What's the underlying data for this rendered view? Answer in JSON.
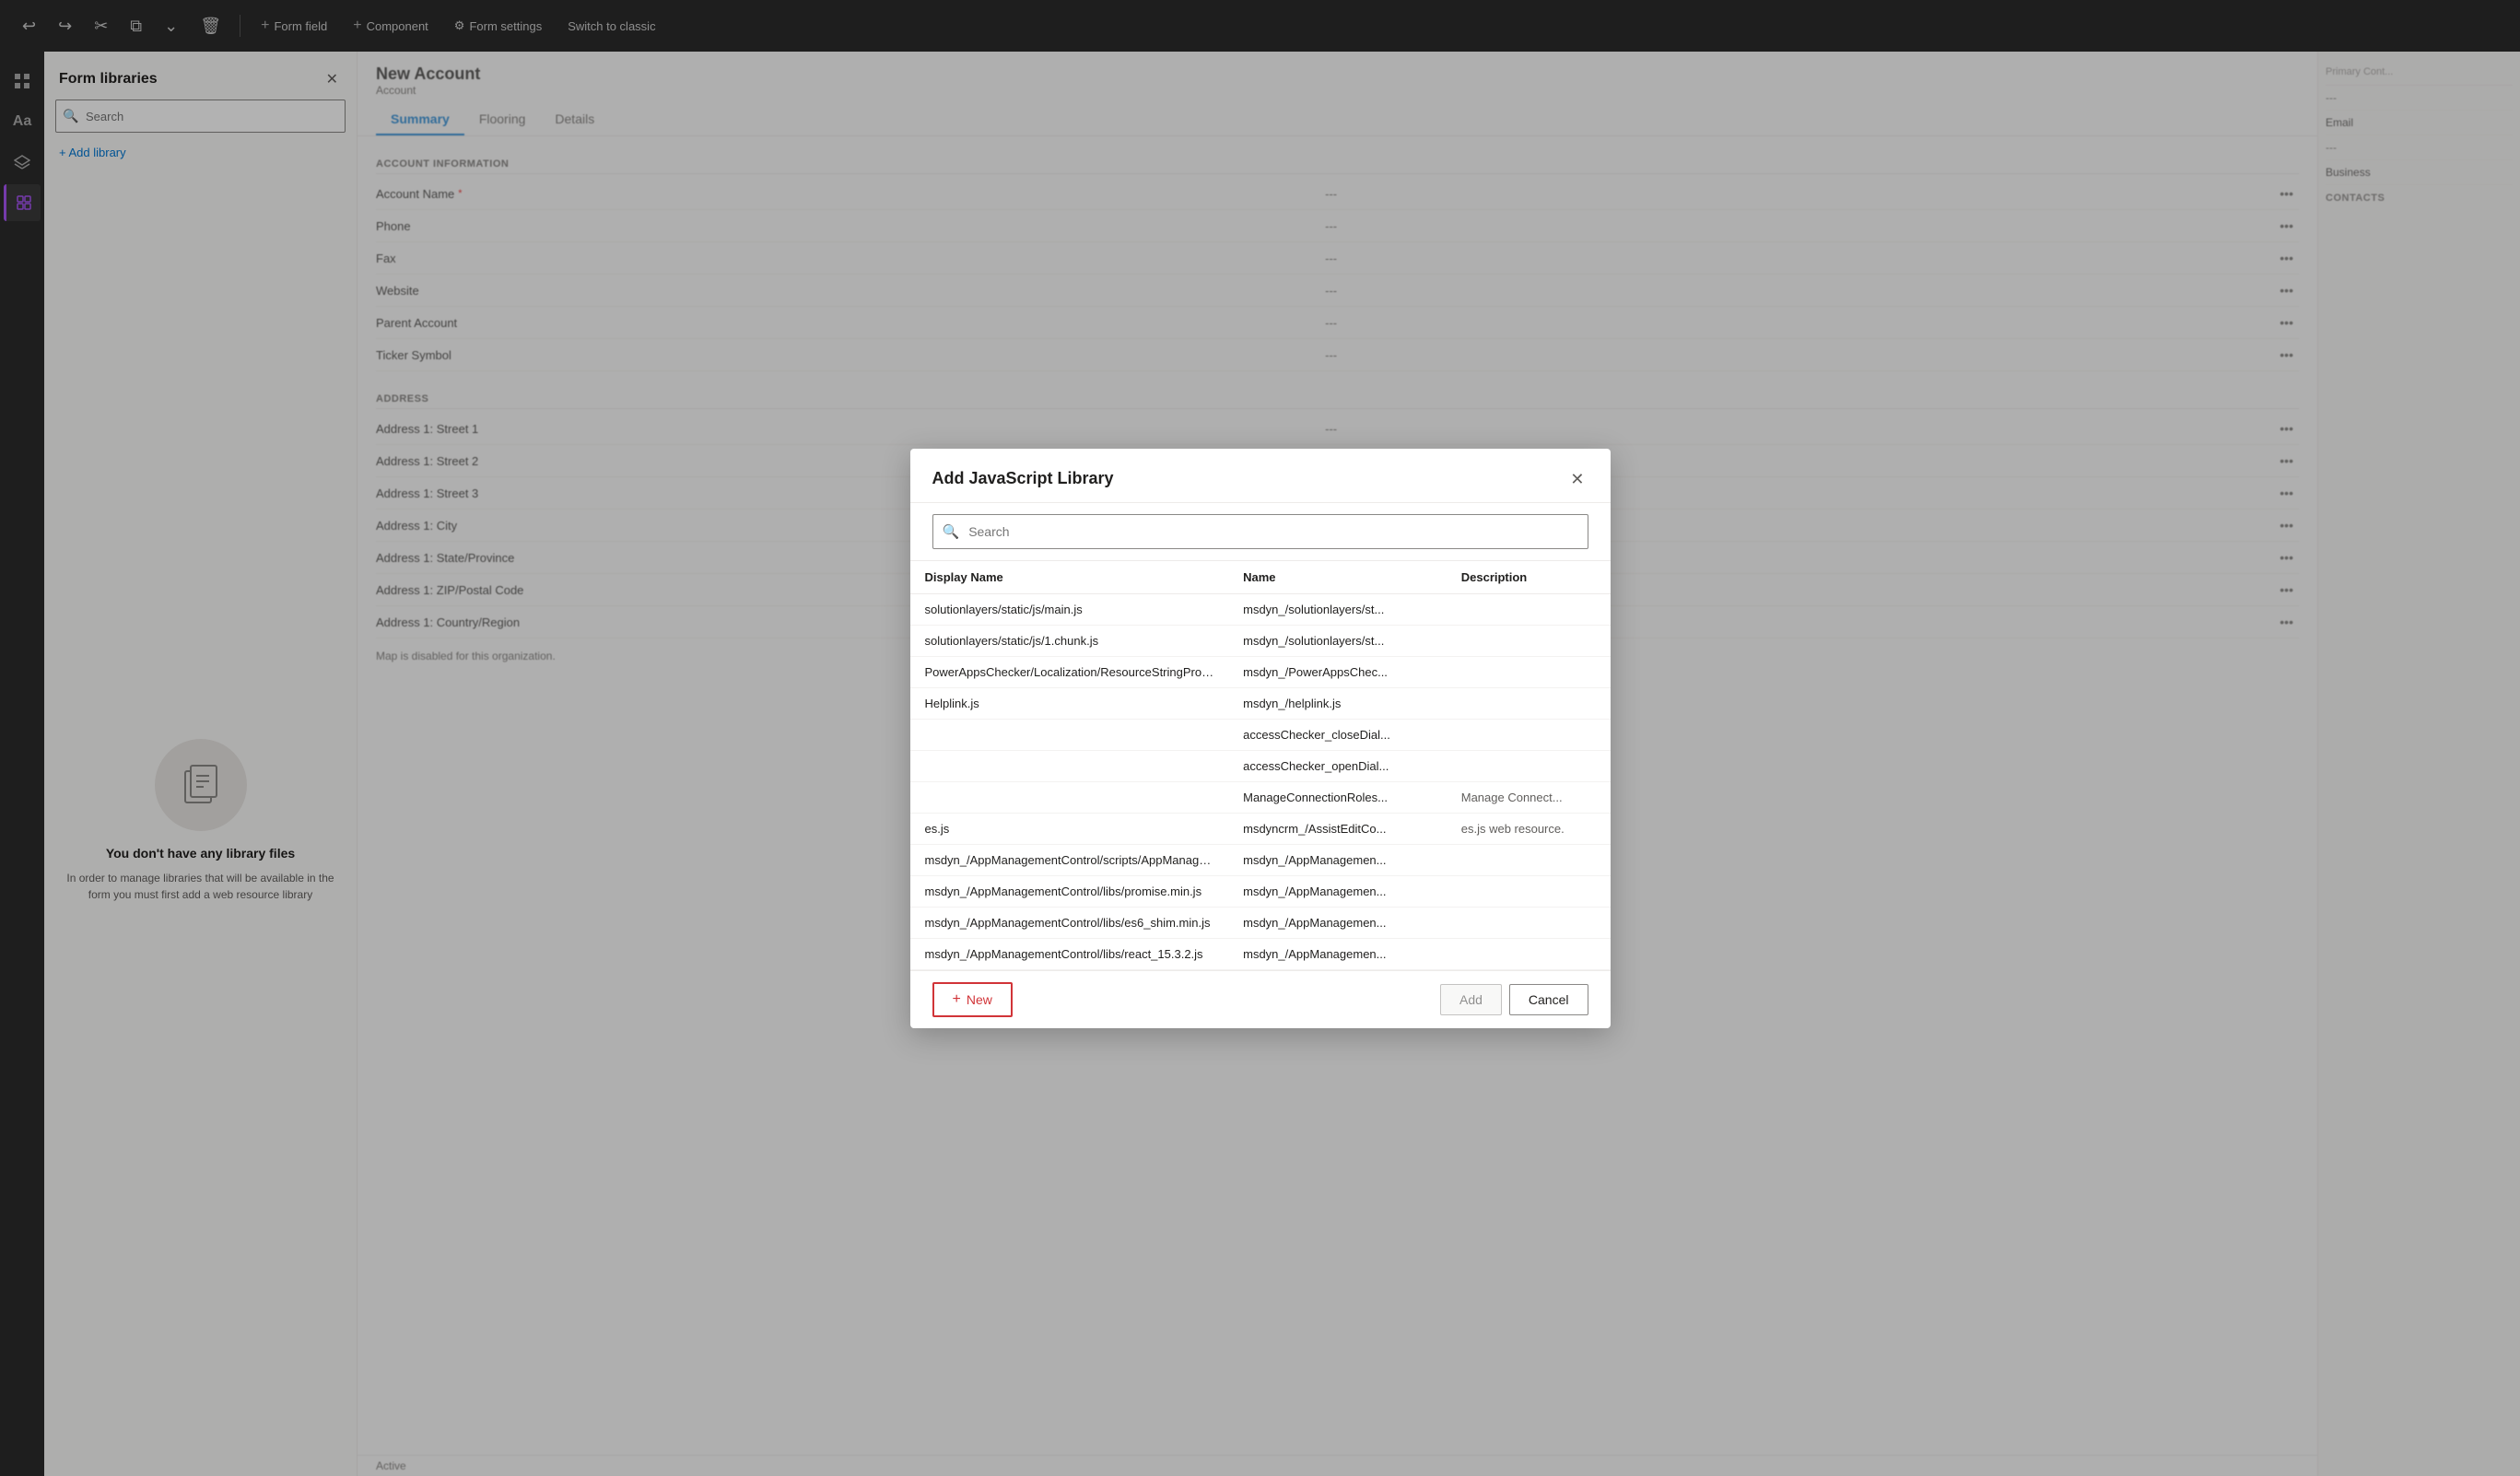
{
  "toolbar": {
    "title": "Form field",
    "undo_label": "↩",
    "redo_label": "↪",
    "cut_label": "✂",
    "copy_label": "⧉",
    "expand_label": "⌄",
    "delete_label": "🗑",
    "form_field_label": "+ Form field",
    "component_label": "+ Component",
    "form_settings_label": "Form settings",
    "switch_classic_label": "Switch to classic"
  },
  "sidebar": {
    "icons": [
      "⊞",
      "Aa",
      "⊕",
      "⧉"
    ]
  },
  "form_libraries": {
    "panel_title": "Form libraries",
    "search_placeholder": "Search",
    "add_library_label": "+ Add library",
    "empty_title": "You don't have any library files",
    "empty_desc": "In order to manage libraries that will be available in the form you must first add a web resource library"
  },
  "form": {
    "title": "New Account",
    "subtitle": "Account",
    "tabs": [
      "Summary",
      "Flooring",
      "Details"
    ],
    "active_tab": "Summary",
    "sections": [
      {
        "header": "ACCOUNT INFORMATION",
        "fields": [
          {
            "label": "Account Name",
            "required": true,
            "value": "---"
          },
          {
            "label": "Phone",
            "required": false,
            "value": "---"
          },
          {
            "label": "Fax",
            "required": false,
            "value": "---"
          },
          {
            "label": "Website",
            "required": false,
            "value": "---"
          },
          {
            "label": "Parent Account",
            "required": false,
            "value": "---"
          },
          {
            "label": "Ticker Symbol",
            "required": false,
            "value": "---"
          }
        ]
      },
      {
        "header": "ADDRESS",
        "fields": [
          {
            "label": "Address 1: Street 1",
            "required": false,
            "value": "---"
          },
          {
            "label": "Address 1: Street 2",
            "required": false,
            "value": "---"
          },
          {
            "label": "Address 1: Street 3",
            "required": false,
            "value": "---"
          },
          {
            "label": "Address 1: City",
            "required": false,
            "value": "---"
          },
          {
            "label": "Address 1: State/Province",
            "required": false,
            "value": "---"
          },
          {
            "label": "Address 1: ZIP/Postal Code",
            "required": false,
            "value": "---"
          },
          {
            "label": "Address 1: Country/Region",
            "required": false,
            "value": "---"
          }
        ]
      }
    ],
    "map_disabled_text": "Map is disabled for this organization.",
    "status_label": "Active"
  },
  "right_panel": {
    "items": [
      "---",
      "Email",
      "---",
      "Business",
      "CONTACTS"
    ]
  },
  "modal": {
    "title": "Add JavaScript Library",
    "search_placeholder": "Search",
    "columns": {
      "display_name": "Display Name",
      "name": "Name",
      "description": "Description"
    },
    "rows": [
      {
        "display_name": "solutionlayers/static/js/main.js",
        "name": "msdyn_/solutionlayers/st...",
        "description": ""
      },
      {
        "display_name": "solutionlayers/static/js/1.chunk.js",
        "name": "msdyn_/solutionlayers/st...",
        "description": ""
      },
      {
        "display_name": "PowerAppsChecker/Localization/ResourceStringProvid...",
        "name": "msdyn_/PowerAppsChec...",
        "description": ""
      },
      {
        "display_name": "Helplink.js",
        "name": "msdyn_/helplink.js",
        "description": ""
      },
      {
        "display_name": "",
        "name": "accessChecker_closeDial...",
        "description": ""
      },
      {
        "display_name": "",
        "name": "accessChecker_openDial...",
        "description": ""
      },
      {
        "display_name": "",
        "name": "ManageConnectionRoles...",
        "description": "Manage Connect..."
      },
      {
        "display_name": "es.js",
        "name": "msdyncrm_/AssistEditCo...",
        "description": "es.js web resource."
      },
      {
        "display_name": "msdyn_/AppManagementControl/scripts/AppManage...",
        "name": "msdyn_/AppManagemen...",
        "description": ""
      },
      {
        "display_name": "msdyn_/AppManagementControl/libs/promise.min.js",
        "name": "msdyn_/AppManagemen...",
        "description": ""
      },
      {
        "display_name": "msdyn_/AppManagementControl/libs/es6_shim.min.js",
        "name": "msdyn_/AppManagemen...",
        "description": ""
      },
      {
        "display_name": "msdyn_/AppManagementControl/libs/react_15.3.2.js",
        "name": "msdyn_/AppManagemen...",
        "description": ""
      }
    ],
    "new_button_label": "New",
    "add_button_label": "Add",
    "cancel_button_label": "Cancel"
  }
}
